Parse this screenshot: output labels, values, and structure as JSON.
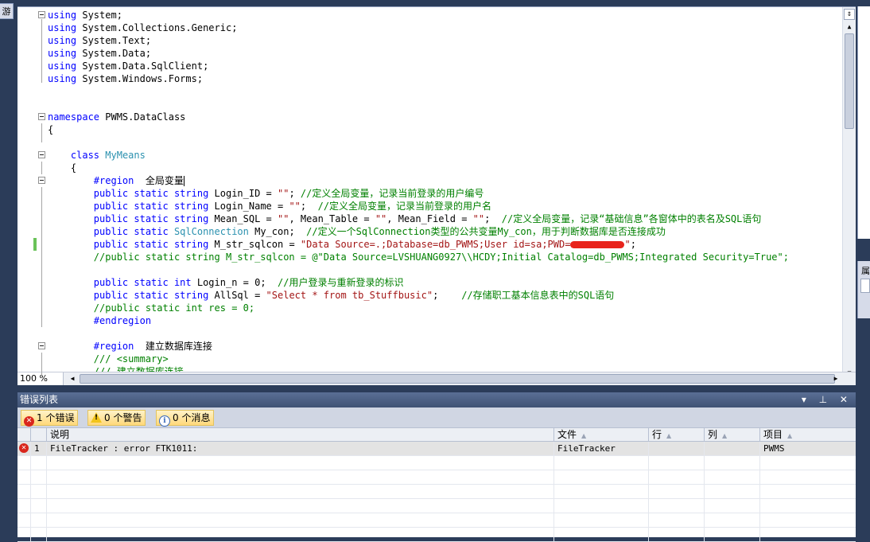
{
  "left_tab_label": "游",
  "editor": {
    "zoom": "100 %",
    "lines": [
      [
        [
          "kw",
          "using"
        ],
        [
          "pl",
          " System;"
        ]
      ],
      [
        [
          "kw",
          "using"
        ],
        [
          "pl",
          " System.Collections.Generic;"
        ]
      ],
      [
        [
          "kw",
          "using"
        ],
        [
          "pl",
          " System.Text;"
        ]
      ],
      [
        [
          "kw",
          "using"
        ],
        [
          "pl",
          " System.Data;"
        ]
      ],
      [
        [
          "kw",
          "using"
        ],
        [
          "pl",
          " System.Data.SqlClient;"
        ]
      ],
      [
        [
          "kw",
          "using"
        ],
        [
          "pl",
          " System.Windows.Forms;"
        ]
      ],
      [],
      [],
      [
        [
          "kw",
          "namespace"
        ],
        [
          "pl",
          " PWMS.DataClass"
        ]
      ],
      [
        [
          "pl",
          "{"
        ]
      ],
      [],
      [
        [
          "pl",
          "    "
        ],
        [
          "kw",
          "class"
        ],
        [
          "pl",
          " "
        ],
        [
          "ty",
          "MyMeans"
        ]
      ],
      [
        [
          "pl",
          "    {"
        ]
      ],
      [
        [
          "pl",
          "        "
        ],
        [
          "kw",
          "#region"
        ],
        [
          "pl",
          "  全局变量"
        ],
        [
          "caret",
          ""
        ]
      ],
      [
        [
          "pl",
          "        "
        ],
        [
          "kw",
          "public static string"
        ],
        [
          "pl",
          " Login_ID = "
        ],
        [
          "st",
          "\"\""
        ],
        [
          "pl",
          "; "
        ],
        [
          "cm",
          "//定义全局变量，记录当前登录的用户编号"
        ]
      ],
      [
        [
          "pl",
          "        "
        ],
        [
          "kw",
          "public static string"
        ],
        [
          "pl",
          " Login_Name = "
        ],
        [
          "st",
          "\"\""
        ],
        [
          "pl",
          ";  "
        ],
        [
          "cm",
          "//定义全局变量，记录当前登录的用户名"
        ]
      ],
      [
        [
          "pl",
          "        "
        ],
        [
          "kw",
          "public static string"
        ],
        [
          "pl",
          " Mean_SQL = "
        ],
        [
          "st",
          "\"\""
        ],
        [
          "pl",
          ", Mean_Table = "
        ],
        [
          "st",
          "\"\""
        ],
        [
          "pl",
          ", Mean_Field = "
        ],
        [
          "st",
          "\"\""
        ],
        [
          "pl",
          ";  "
        ],
        [
          "cm",
          "//定义全局变量，记录“基础信息”各窗体中的表名及SQL语句"
        ]
      ],
      [
        [
          "pl",
          "        "
        ],
        [
          "kw",
          "public static"
        ],
        [
          "pl",
          " "
        ],
        [
          "ty",
          "SqlConnection"
        ],
        [
          "pl",
          " My_con;  "
        ],
        [
          "cm",
          "//定义一个SqlConnection类型的公共变量My_con，用于判断数据库是否连接成功"
        ]
      ],
      [
        [
          "pl",
          "        "
        ],
        [
          "kw",
          "public static string"
        ],
        [
          "pl",
          " M_str_sqlcon = "
        ],
        [
          "st",
          "\"Data Source=.;Database=db_PWMS;User id=sa;PWD="
        ],
        [
          "redact",
          ""
        ],
        [
          "st",
          "\""
        ],
        [
          "pl",
          ";"
        ]
      ],
      [
        [
          "pl",
          "        "
        ],
        [
          "cm",
          "//public static string M_str_sqlcon = @\"Data Source=LVSHUANG0927\\\\HCDY;Initial Catalog=db_PWMS;Integrated Security=True\";"
        ]
      ],
      [],
      [
        [
          "pl",
          "        "
        ],
        [
          "kw",
          "public static int"
        ],
        [
          "pl",
          " Login_n = 0;  "
        ],
        [
          "cm",
          "//用户登录与重新登录的标识"
        ]
      ],
      [
        [
          "pl",
          "        "
        ],
        [
          "kw",
          "public static string"
        ],
        [
          "pl",
          " AllSql = "
        ],
        [
          "st",
          "\"Select * from tb_Stuffbusic\""
        ],
        [
          "pl",
          ";    "
        ],
        [
          "cm",
          "//存储职工基本信息表中的SQL语句"
        ]
      ],
      [
        [
          "pl",
          "        "
        ],
        [
          "cm",
          "//public static int res = 0;"
        ]
      ],
      [
        [
          "pl",
          "        "
        ],
        [
          "kw",
          "#endregion"
        ]
      ],
      [],
      [
        [
          "pl",
          "        "
        ],
        [
          "kw",
          "#region"
        ],
        [
          "pl",
          "  建立数据库连接"
        ]
      ],
      [
        [
          "pl",
          "        "
        ],
        [
          "cm",
          "/// <summary>"
        ]
      ],
      [
        [
          "pl",
          "        "
        ],
        [
          "cm",
          "/// 建立数据库连接"
        ]
      ]
    ]
  },
  "error_list": {
    "title": "错误列表",
    "title_buttons": "▾ ⊥ ✕",
    "filters": {
      "errors": "1 个错误",
      "warnings": "0 个警告",
      "messages": "0 个消息"
    },
    "columns": {
      "description": "说明",
      "file": "文件",
      "line": "行",
      "column": "列",
      "project": "项目"
    },
    "rows": [
      {
        "num": "1",
        "description": "FileTracker : error FTK1011:",
        "file": "FileTracker",
        "line": "",
        "column": "",
        "project": "PWMS"
      }
    ]
  },
  "right_panel_label": "属"
}
